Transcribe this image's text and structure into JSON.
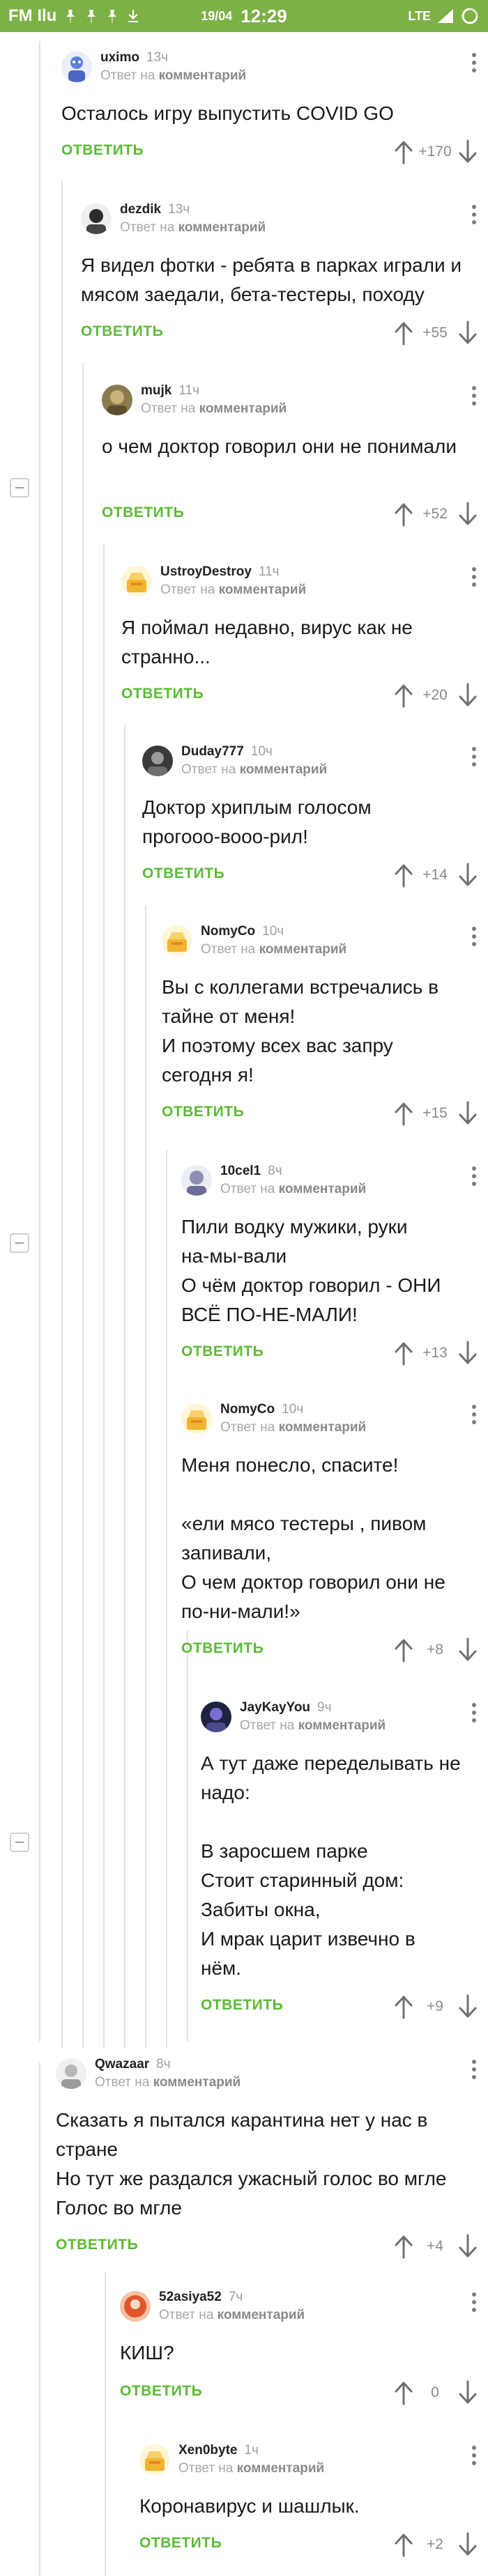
{
  "status_bar": {
    "app": "FM Ilu",
    "date": "19/04",
    "time": "12:29",
    "network": "LTE"
  },
  "labels": {
    "reply_to": "Ответ на",
    "reply_to_target": "комментарий",
    "reply": "ОТВЕТИТЬ"
  },
  "comments": [
    {
      "username": "uximo",
      "time": "13ч",
      "text": "Осталось игру выпустить COVID GO",
      "score": "+170"
    },
    {
      "username": "dezdik",
      "time": "13ч",
      "text": "Я видел фотки - ребята в парках играли и мясом заедали, бета-тестеры, походу",
      "score": "+55"
    },
    {
      "username": "mujk",
      "time": "11ч",
      "text": "о чем доктор говорил они не понимали",
      "score": "+52"
    },
    {
      "username": "UstroyDestroy",
      "time": "11ч",
      "text": "Я поймал недавно, вирус как не странно...",
      "score": "+20"
    },
    {
      "username": "Duday777",
      "time": "10ч",
      "text": "Доктор хриплым голосом\nпрогооо-вооо-рил!",
      "score": "+14"
    },
    {
      "username": "NomyCo",
      "time": "10ч",
      "text": "Вы с коллегами встречались в\nтайне от меня!\nИ поэтому всех вас запру\nсегодня я!",
      "score": "+15"
    },
    {
      "username": "10cel1",
      "time": "8ч",
      "text": "Пили водку мужики, руки\nна-мы-вали\nО чём доктор говорил - ОНИ\nВСЁ ПО-НЕ-МАЛИ!",
      "score": "+13"
    },
    {
      "username": "NomyCo",
      "time": "10ч",
      "text": "Меня понесло, спасите!\n\n«ели мясо тестеры , пивом\nзапивали,\nО чем доктор говорил они не\nпо-ни-мали!»",
      "score": "+8"
    },
    {
      "username": "JayKayYou",
      "time": "9ч",
      "text": "А тут даже переделывать не\nнадо:\n\nВ заросшем парке\nСтоит старинный дом:\nЗабиты окна,\nИ мрак царит извечно в\nнём.",
      "score": "+9"
    },
    {
      "username": "Qwazaar",
      "time": "8ч",
      "text": "Сказать я пытался карантина нет у нас в\nстране\nНо тут же раздался ужасный голос во мгле\nГолос во мгле",
      "score": "+4"
    },
    {
      "username": "52asiya52",
      "time": "7ч",
      "text": "КИШ?",
      "score": "0"
    },
    {
      "username": "Xen0byte",
      "time": "1ч",
      "text": "Коронавирус и шашлык.",
      "score": "+2"
    }
  ],
  "colors": {
    "accent_green": "#5bbb34",
    "status_bar_green": "#7db045"
  }
}
